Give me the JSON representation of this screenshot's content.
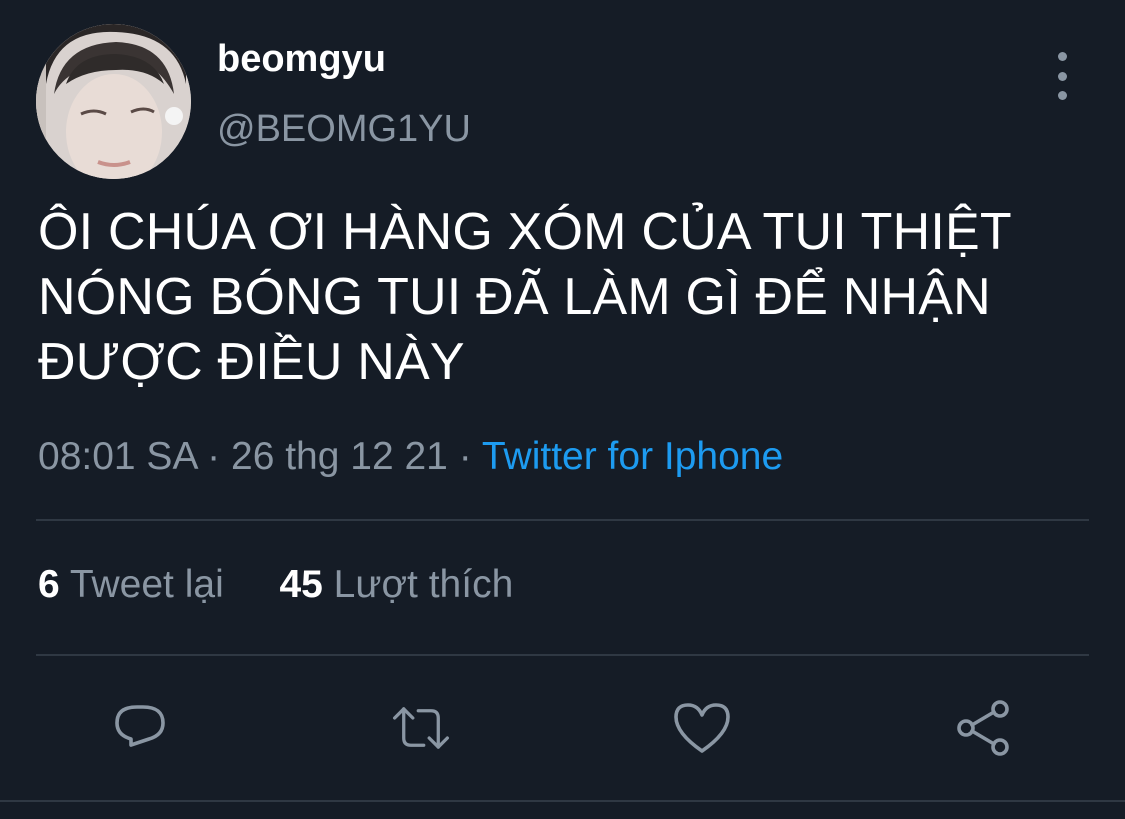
{
  "user": {
    "display_name": "beomgyu",
    "handle": "@BEOMG1YU"
  },
  "tweet": {
    "text_lines": [
      "ÔI CHÚA ƠI HÀNG XÓM CỦA TUI THIỆT",
      "NÓNG BÓNG TUI ĐÃ LÀM GÌ ĐỂ NHẬN",
      "ĐƯỢC ĐIỀU NÀY"
    ],
    "time": "08:01 SA",
    "date": "26 thg 12 21",
    "separator": "·",
    "source": "Twitter for Iphone"
  },
  "stats": {
    "retweets_count": "6",
    "retweets_label": "Tweet lại",
    "likes_count": "45",
    "likes_label": "Lượt thích"
  },
  "icons": {
    "more": "more-vertical-icon",
    "reply": "reply-icon",
    "retweet": "retweet-icon",
    "like": "heart-icon",
    "share": "share-icon"
  },
  "colors": {
    "background": "#151c26",
    "secondary_text": "#8a96a3",
    "link": "#1d9bf0",
    "divider": "#2f3843"
  }
}
